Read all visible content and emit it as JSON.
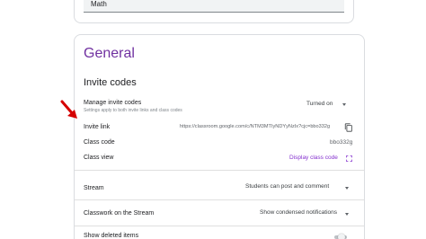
{
  "subject": {
    "value": "Math"
  },
  "general": {
    "title": "General",
    "invite_section_title": "Invite codes",
    "manage_invite_codes": {
      "label": "Manage invite codes",
      "sublabel": "Settings apply to both invite links and class codes",
      "value": "Turned on"
    },
    "invite_link": {
      "label": "Invite link",
      "value": "https://classroom.google.com/c/NTM3MTIyNDYyNzIx?cjc=bbo332g"
    },
    "class_code": {
      "label": "Class code",
      "value": "bbo332g"
    },
    "class_view": {
      "label": "Class view",
      "action": "Display class code"
    },
    "stream": {
      "label": "Stream",
      "value": "Students can post and comment"
    },
    "classwork_on_stream": {
      "label": "Classwork on the Stream",
      "value": "Show condensed notifications"
    },
    "show_deleted_items": {
      "label": "Show deleted items"
    }
  },
  "colors": {
    "accent": "#7030a0",
    "arrow": "#d50000"
  }
}
